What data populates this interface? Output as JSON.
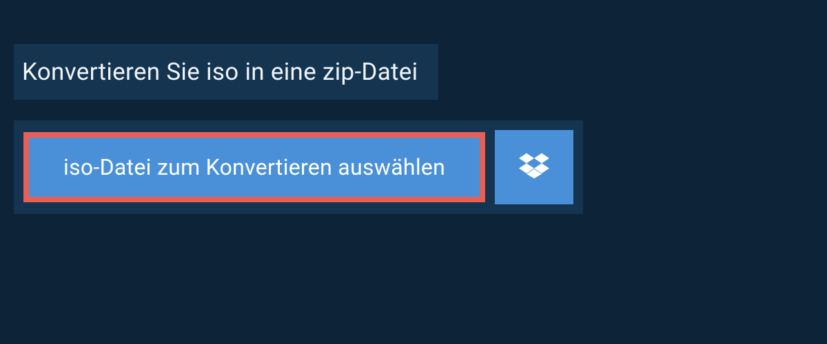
{
  "header": {
    "title": "Konvertieren Sie iso in eine zip-Datei"
  },
  "upload": {
    "select_file_label": "iso-Datei zum Konvertieren auswählen"
  },
  "colors": {
    "page_bg": "#0d2438",
    "panel_bg": "#153450",
    "button_bg": "#4a90d9",
    "highlight_border": "#e85f56"
  }
}
